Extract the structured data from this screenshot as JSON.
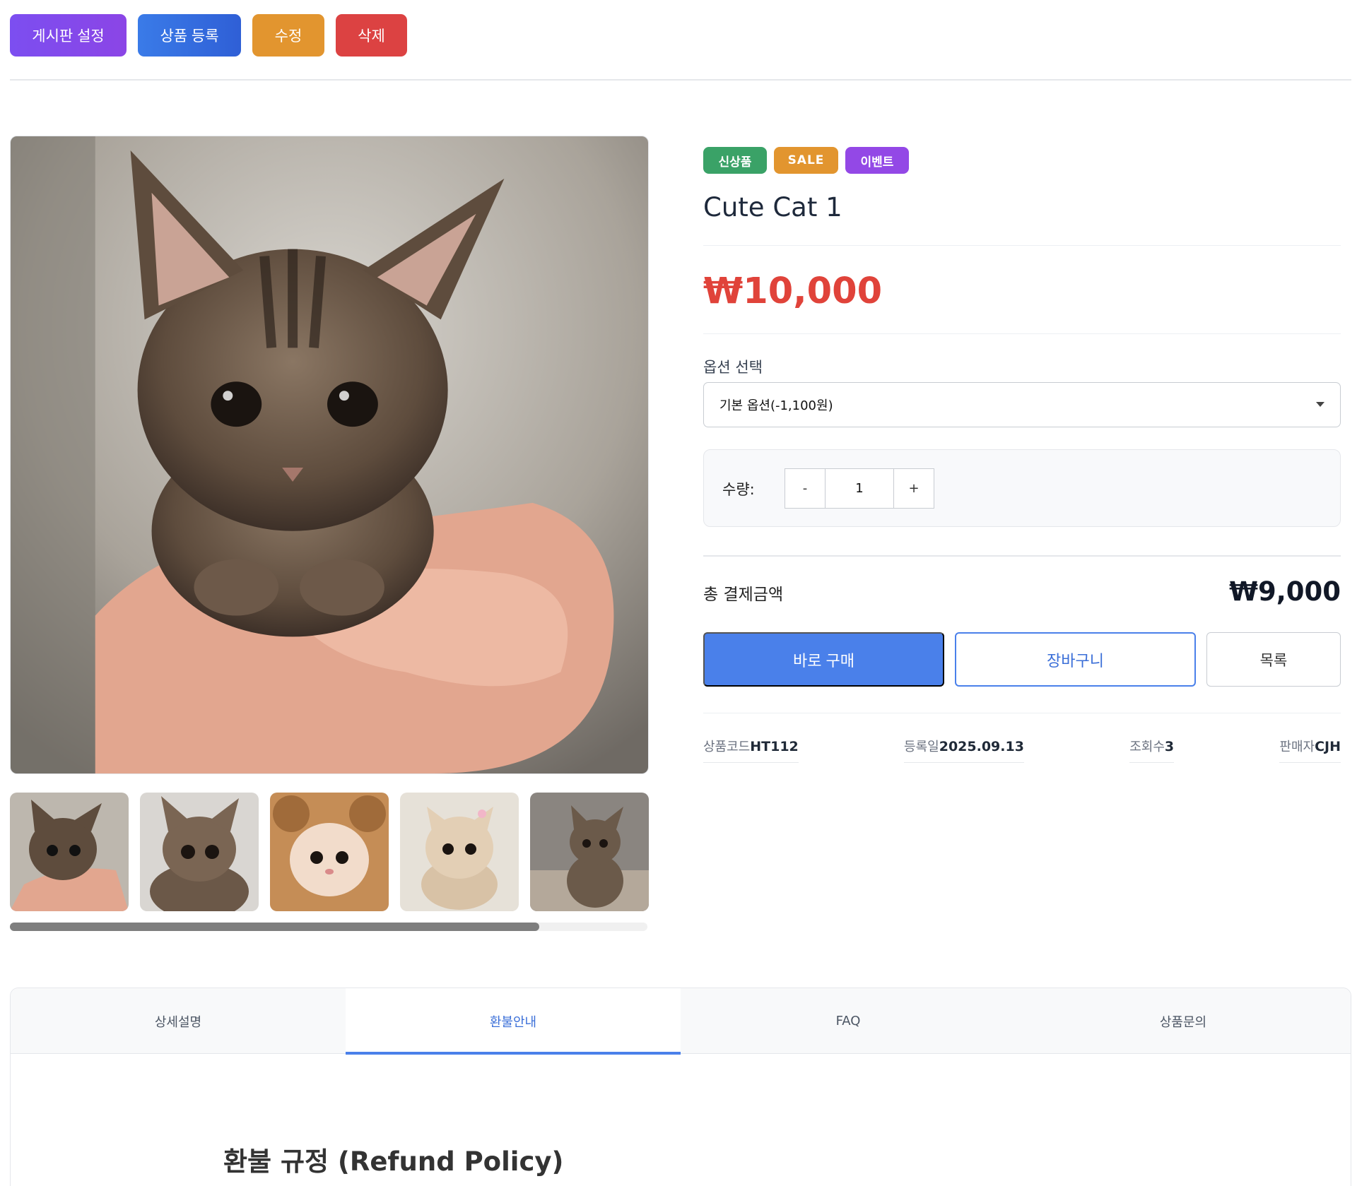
{
  "admin": {
    "board_settings": "게시판 설정",
    "register_product": "상품 등록",
    "edit": "수정",
    "delete": "삭제"
  },
  "product": {
    "badges": [
      "신상품",
      "SALE",
      "이벤트"
    ],
    "badge_colors": [
      "#3aa267",
      "#e2952f",
      "#9348e6"
    ],
    "title": "Cute Cat 1",
    "price": "₩10,000",
    "price_color": "#e0433a",
    "option_label": "옵션 선택",
    "option_selected": "기본 옵션(-1,100원)",
    "qty_label": "수량:",
    "qty_minus": "-",
    "qty_value": "1",
    "qty_plus": "+",
    "total_label": "총 결제금액",
    "total_value": "₩9,000",
    "buy_now": "바로 구매",
    "cart": "장바구니",
    "list": "목록",
    "accent_color": "#4a80ea",
    "meta": [
      {
        "key": "상품코드",
        "value": "HT112"
      },
      {
        "key": "등록일",
        "value": "2025.09.13"
      },
      {
        "key": "조회수",
        "value": "3"
      },
      {
        "key": "판매자",
        "value": "CJH"
      }
    ]
  },
  "gallery": {
    "thumbnail_count": 5,
    "scroll_position_fraction": 0.83
  },
  "tabs": {
    "items": [
      "상세설명",
      "환불안내",
      "FAQ",
      "상품문의"
    ],
    "active": "환불안내"
  },
  "refund": {
    "title": "환불 규정 (Refund Policy)"
  }
}
